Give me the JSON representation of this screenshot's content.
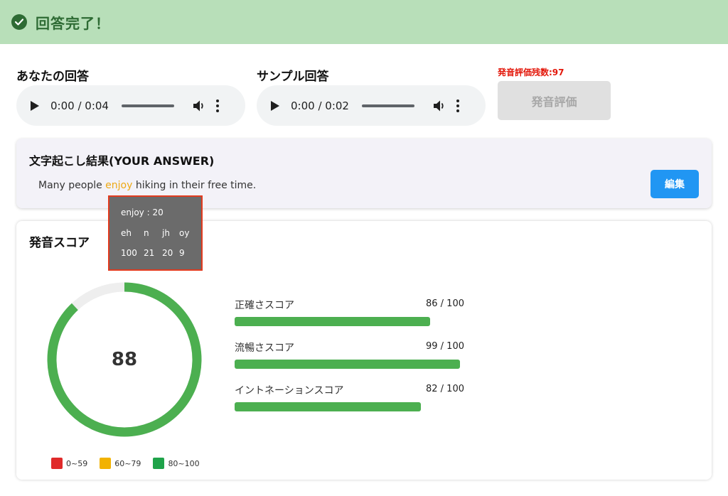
{
  "banner": {
    "title": "回答完了！"
  },
  "your_answer": {
    "label": "あなたの回答",
    "time": "0:00 / 0:04"
  },
  "sample_answer": {
    "label": "サンプル回答",
    "time": "0:00 / 0:02"
  },
  "evaluation": {
    "remaining": "発音評価残数:97",
    "button_label": "発音評価"
  },
  "transcript": {
    "title": "文字起こし結果(YOUR ANSWER)",
    "text_before": "Many people ",
    "highlighted_word": "enjoy",
    "text_after": " hiking in their free time.",
    "edit_label": "編集"
  },
  "tooltip": {
    "word_score": "enjoy : 20",
    "phonemes": [
      "eh",
      "n",
      "jh",
      "oy"
    ],
    "phoneme_scores": [
      "100",
      "21",
      "20",
      "9"
    ]
  },
  "score": {
    "title": "発音スコア",
    "total": "88",
    "total_value": 88,
    "metrics": [
      {
        "label": "正確さスコア",
        "value_text": "86 / 100",
        "value": 86
      },
      {
        "label": "流暢さスコア",
        "value_text": "99 / 100",
        "value": 99
      },
      {
        "label": "イントネーションスコア",
        "value_text": "82 / 100",
        "value": 82
      }
    ],
    "legend": [
      {
        "label": "0~59",
        "color": "#e02a2a"
      },
      {
        "label": "60~79",
        "color": "#f2b200"
      },
      {
        "label": "80~100",
        "color": "#1fa34a"
      }
    ]
  },
  "colors": {
    "banner_bg": "#b8dfb9",
    "banner_text": "#2e6b34",
    "score_green": "#4caf50",
    "highlight": "#eda915",
    "edit_button": "#2196f3",
    "remaining_text": "#e3170a"
  }
}
